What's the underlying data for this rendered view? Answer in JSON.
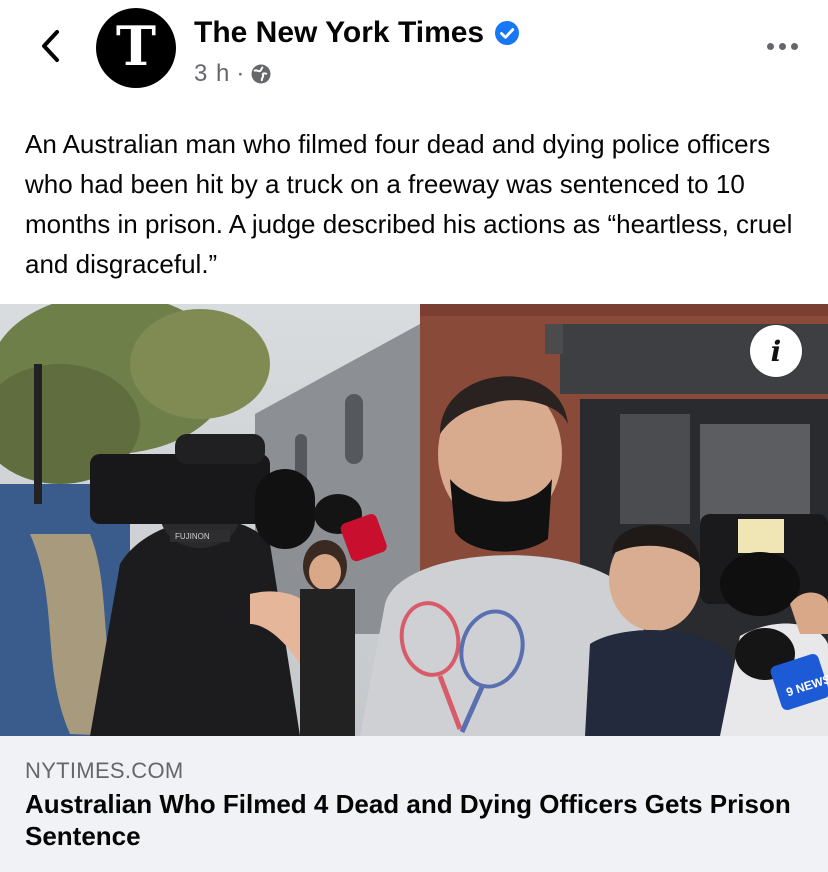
{
  "post": {
    "page_name": "The New York Times",
    "avatar_glyph": "T",
    "time": "3 h",
    "separator": "·",
    "verified": true,
    "privacy_icon": "globe-icon",
    "caption": "An Australian man who filmed four dead and dying police officers who had been hit by a truck on a freeway was sentenced to 10 months in prison. A judge described his actions as “heartless, cruel and disgraceful.”"
  },
  "photo": {
    "info_label": "i",
    "camera_brand": "FUJINON",
    "channel_badge": "9 NEWS"
  },
  "link_preview": {
    "domain": "NYTIMES.COM",
    "title": "Australian Who Filmed 4 Dead and Dying Officers Gets Prison Sentence"
  },
  "colors": {
    "verified": "#1877f2",
    "secondary_text": "#65676b",
    "link_bg": "#f0f2f5"
  }
}
